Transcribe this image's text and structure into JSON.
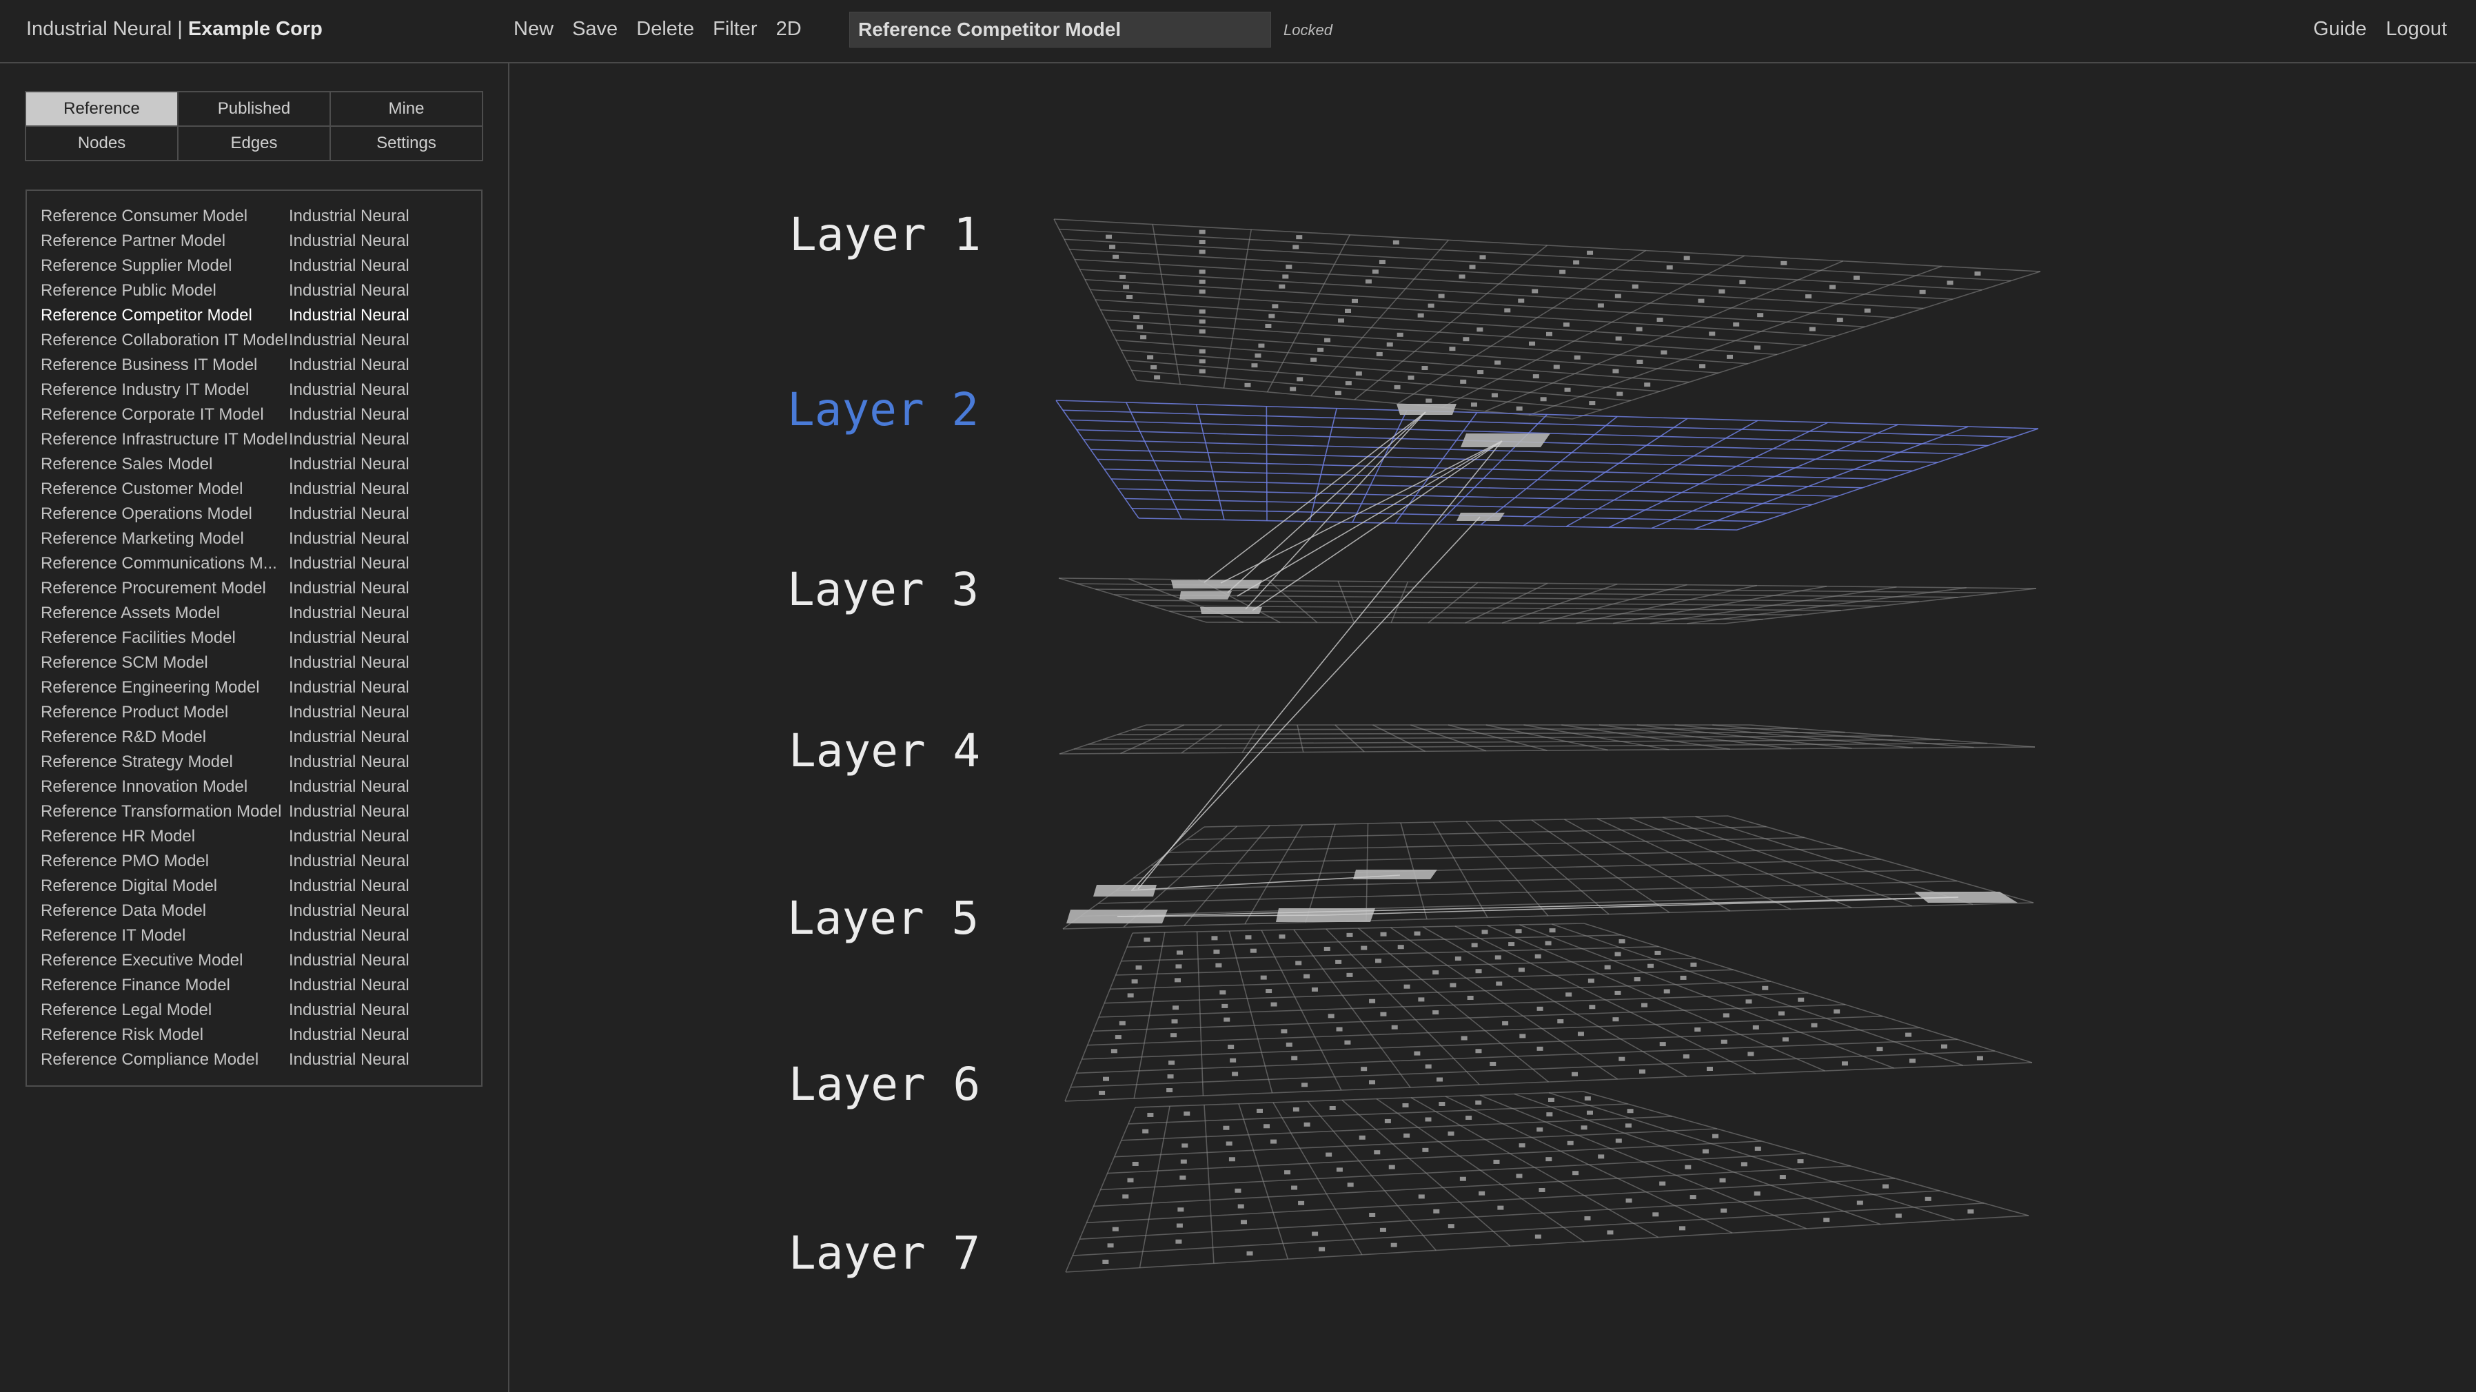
{
  "header": {
    "brand_prefix": "Industrial Neural |",
    "brand_company": "Example Corp",
    "menu": [
      "New",
      "Save",
      "Delete",
      "Filter",
      "2D"
    ],
    "model_title": "Reference Competitor Model",
    "lock_status": "Locked",
    "right_links": [
      "Guide",
      "Logout"
    ]
  },
  "sidebar": {
    "tabs_row1": [
      "Reference",
      "Published",
      "Mine"
    ],
    "tabs_row2": [
      "Nodes",
      "Edges",
      "Settings"
    ],
    "active_tab": "Reference",
    "models": [
      {
        "name": "Reference Consumer Model",
        "owner": "Industrial Neural"
      },
      {
        "name": "Reference Partner Model",
        "owner": "Industrial Neural"
      },
      {
        "name": "Reference Supplier Model",
        "owner": "Industrial Neural"
      },
      {
        "name": "Reference Public Model",
        "owner": "Industrial Neural"
      },
      {
        "name": "Reference Competitor Model",
        "owner": "Industrial Neural"
      },
      {
        "name": "Reference Collaboration IT Model",
        "owner": "Industrial Neural"
      },
      {
        "name": "Reference Business IT Model",
        "owner": "Industrial Neural"
      },
      {
        "name": "Reference Industry IT Model",
        "owner": "Industrial Neural"
      },
      {
        "name": "Reference Corporate IT Model",
        "owner": "Industrial Neural"
      },
      {
        "name": "Reference Infrastructure IT Model",
        "owner": "Industrial Neural"
      },
      {
        "name": "Reference Sales Model",
        "owner": "Industrial Neural"
      },
      {
        "name": "Reference Customer Model",
        "owner": "Industrial Neural"
      },
      {
        "name": "Reference Operations Model",
        "owner": "Industrial Neural"
      },
      {
        "name": "Reference Marketing Model",
        "owner": "Industrial Neural"
      },
      {
        "name": "Reference Communications M...",
        "owner": "Industrial Neural"
      },
      {
        "name": "Reference Procurement Model",
        "owner": "Industrial Neural"
      },
      {
        "name": "Reference Assets Model",
        "owner": "Industrial Neural"
      },
      {
        "name": "Reference Facilities Model",
        "owner": "Industrial Neural"
      },
      {
        "name": "Reference SCM Model",
        "owner": "Industrial Neural"
      },
      {
        "name": "Reference Engineering Model",
        "owner": "Industrial Neural"
      },
      {
        "name": "Reference Product Model",
        "owner": "Industrial Neural"
      },
      {
        "name": "Reference R&D Model",
        "owner": "Industrial Neural"
      },
      {
        "name": "Reference Strategy Model",
        "owner": "Industrial Neural"
      },
      {
        "name": "Reference Innovation Model",
        "owner": "Industrial Neural"
      },
      {
        "name": "Reference Transformation Model",
        "owner": "Industrial Neural"
      },
      {
        "name": "Reference HR Model",
        "owner": "Industrial Neural"
      },
      {
        "name": "Reference PMO Model",
        "owner": "Industrial Neural"
      },
      {
        "name": "Reference Digital Model",
        "owner": "Industrial Neural"
      },
      {
        "name": "Reference Data Model",
        "owner": "Industrial Neural"
      },
      {
        "name": "Reference IT Model",
        "owner": "Industrial Neural"
      },
      {
        "name": "Reference Executive Model",
        "owner": "Industrial Neural"
      },
      {
        "name": "Reference Finance Model",
        "owner": "Industrial Neural"
      },
      {
        "name": "Reference Legal Model",
        "owner": "Industrial Neural"
      },
      {
        "name": "Reference Risk Model",
        "owner": "Industrial Neural"
      },
      {
        "name": "Reference Compliance Model",
        "owner": "Industrial Neural"
      }
    ],
    "selected_model": "Reference Competitor Model"
  },
  "viewer": {
    "layers": [
      "Layer 1",
      "Layer 2",
      "Layer 3",
      "Layer 4",
      "Layer 5",
      "Layer 6",
      "Layer 7"
    ],
    "active_layer": "Layer 2",
    "colors": {
      "grid": "#8a8a8a",
      "active_grid": "#6f7fe0",
      "node": "#b5b5b5",
      "edge": "#d0d0d0",
      "active_label": "#4a7bd8"
    }
  }
}
